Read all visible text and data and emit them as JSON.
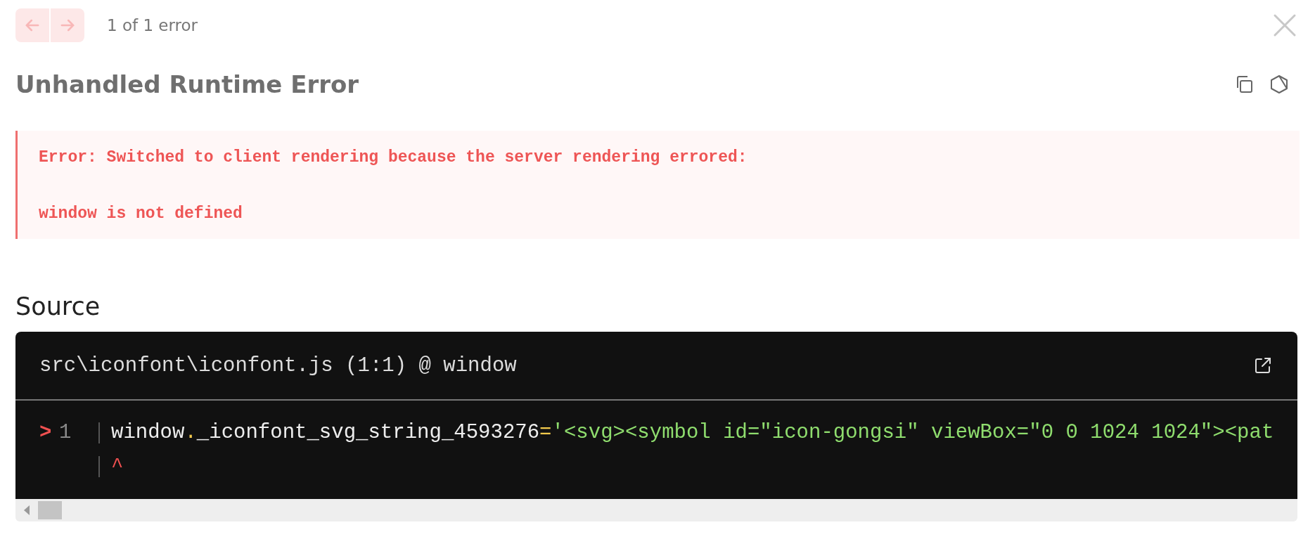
{
  "nav": {
    "buttons": [
      {
        "kind": "prev",
        "disabled": true
      },
      {
        "kind": "next",
        "disabled": true
      }
    ],
    "counter": "1 of 1 error"
  },
  "title": "Unhandled Runtime Error",
  "error_message": [
    "Error: Switched to client rendering because the server rendering errored:",
    "window is not defined"
  ],
  "source": {
    "heading": "Source",
    "file": "src\\iconfont\\iconfont.js (1:1) @ window",
    "lines": [
      {
        "marker": ">",
        "number": "1",
        "tokens": [
          {
            "kind": "plain",
            "text": "window"
          },
          {
            "kind": "punct",
            "text": "."
          },
          {
            "kind": "plain",
            "text": "_iconfont_svg_string_4593276"
          },
          {
            "kind": "punct",
            "text": "="
          },
          {
            "kind": "string",
            "text": "'<svg><symbol id=\"icon-gongsi\" viewBox=\"0 0 1024 1024\"><pat"
          }
        ]
      }
    ],
    "caret": "^"
  }
}
